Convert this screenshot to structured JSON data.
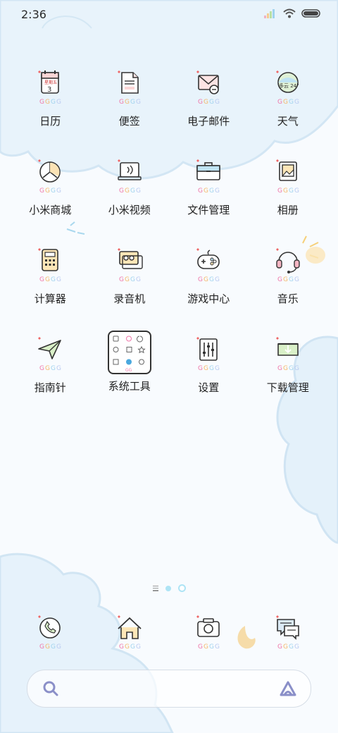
{
  "status_bar": {
    "time": "2:36"
  },
  "apps": [
    {
      "label": "日历",
      "icon": "calendar-icon",
      "badge": "星期五",
      "day": "3"
    },
    {
      "label": "便签",
      "icon": "notes-icon"
    },
    {
      "label": "电子邮件",
      "icon": "email-icon"
    },
    {
      "label": "天气",
      "icon": "weather-icon",
      "badge": "多云 24°"
    },
    {
      "label": "小米商城",
      "icon": "mi-store-icon"
    },
    {
      "label": "小米视频",
      "icon": "mi-video-icon"
    },
    {
      "label": "文件管理",
      "icon": "file-manager-icon"
    },
    {
      "label": "相册",
      "icon": "gallery-icon"
    },
    {
      "label": "计算器",
      "icon": "calculator-icon"
    },
    {
      "label": "录音机",
      "icon": "recorder-icon"
    },
    {
      "label": "游戏中心",
      "icon": "game-center-icon"
    },
    {
      "label": "音乐",
      "icon": "music-icon"
    },
    {
      "label": "指南针",
      "icon": "compass-icon"
    },
    {
      "label": "系统工具",
      "icon": "system-tools-folder-icon"
    },
    {
      "label": "设置",
      "icon": "settings-icon"
    },
    {
      "label": "下载管理",
      "icon": "download-manager-icon"
    }
  ],
  "dock": [
    {
      "icon": "phone-icon"
    },
    {
      "icon": "home-icon"
    },
    {
      "icon": "camera-icon"
    },
    {
      "icon": "messages-icon"
    }
  ],
  "colors": {
    "accent": "#8fd6f0",
    "page_active": "#aee4f5",
    "search_icon": "#8a8fc8"
  }
}
